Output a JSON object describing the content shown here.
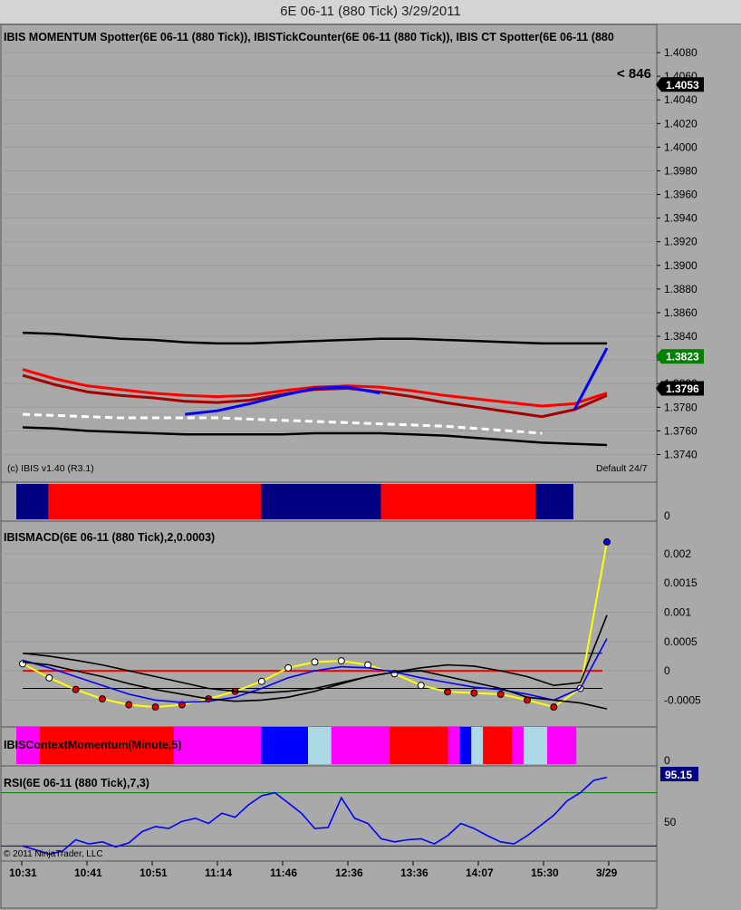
{
  "window": {
    "title": "6E 06-11 (880 Tick)  3/29/2011"
  },
  "colors": {
    "background": "#a9a9a9",
    "red": "#ff0000",
    "darkred": "#a50000",
    "blue": "#0000ff",
    "navy": "#000080",
    "magenta": "#ff00ff",
    "lightblue": "#add8e6",
    "yellow": "#ffff00",
    "cyan": "#00ffff",
    "black": "#000000",
    "white": "#ffffff",
    "green": "#008000"
  },
  "price_panel": {
    "header": "IBIS MOMENTUM Spotter(6E 06-11 (880 Tick)), IBISTickCounter(6E 06-11 (880 Tick)), IBIS CT Spotter(6E 06-11 (880",
    "copyright": "(c) IBIS v1.40 (R3.1)",
    "session_label": "Default 24/7",
    "tick_counter_label": "< 846",
    "price_ticks": [
      "1.4080",
      "1.4060",
      "1.4040",
      "1.4020",
      "1.4000",
      "1.3980",
      "1.3960",
      "1.3940",
      "1.3920",
      "1.3900",
      "1.3880",
      "1.3860",
      "1.3840",
      "1.3820",
      "1.3800",
      "1.3780",
      "1.3760",
      "1.3740"
    ],
    "badges": [
      {
        "value": "1.4053",
        "color": "#000000"
      },
      {
        "value": "1.3823",
        "color": "#008000"
      },
      {
        "value": "1.3796",
        "color": "#000000"
      }
    ]
  },
  "color_bar_1": {
    "zero_label": "0",
    "segments": [
      {
        "color": "navy",
        "from": 0.0,
        "to": 0.055
      },
      {
        "color": "red",
        "from": 0.055,
        "to": 0.42
      },
      {
        "color": "navy",
        "from": 0.42,
        "to": 0.625
      },
      {
        "color": "red",
        "from": 0.625,
        "to": 0.89
      },
      {
        "color": "navy",
        "from": 0.89,
        "to": 0.955
      }
    ]
  },
  "macd_panel": {
    "header": "IBISMACD(6E 06-11 (880 Tick),2,0.0003)",
    "ticks": [
      "0.002",
      "0.0015",
      "0.001",
      "0.0005",
      "0",
      "-0.0005"
    ]
  },
  "color_bar_2": {
    "header": "IBISContextMomentum(Minute,5)",
    "zero_label": "0",
    "segments": [
      {
        "color": "magenta",
        "from": 0.0,
        "to": 0.04
      },
      {
        "color": "red",
        "from": 0.04,
        "to": 0.27
      },
      {
        "color": "magenta",
        "from": 0.27,
        "to": 0.42
      },
      {
        "color": "blue",
        "from": 0.42,
        "to": 0.5
      },
      {
        "color": "lightblue",
        "from": 0.5,
        "to": 0.54
      },
      {
        "color": "magenta",
        "from": 0.54,
        "to": 0.64
      },
      {
        "color": "red",
        "from": 0.64,
        "to": 0.74
      },
      {
        "color": "magenta",
        "from": 0.74,
        "to": 0.76
      },
      {
        "color": "blue",
        "from": 0.76,
        "to": 0.78
      },
      {
        "color": "lightblue",
        "from": 0.78,
        "to": 0.8
      },
      {
        "color": "red",
        "from": 0.8,
        "to": 0.85
      },
      {
        "color": "magenta",
        "from": 0.85,
        "to": 0.87
      },
      {
        "color": "lightblue",
        "from": 0.87,
        "to": 0.91
      },
      {
        "color": "magenta",
        "from": 0.91,
        "to": 0.96
      }
    ]
  },
  "rsi_panel": {
    "header": "RSI(6E 06-11 (880 Tick),7,3)",
    "mid_label": "50",
    "badge": "95.15",
    "copyright": "© 2011 NinjaTrader, LLC"
  },
  "time_axis": {
    "labels": [
      "10:31",
      "10:41",
      "10:51",
      "11:14",
      "11:46",
      "12:36",
      "13:36",
      "14:07",
      "15:30",
      "3/29"
    ]
  },
  "chart_data": [
    {
      "type": "line",
      "name": "price_panel",
      "ylim": [
        1.3735,
        1.409
      ],
      "series": [
        {
          "color": "darkred",
          "values": [
            1.3807,
            1.3799,
            1.3793,
            1.379,
            1.3788,
            1.3785,
            1.3784,
            1.3786,
            1.3791,
            1.3795,
            1.3796,
            1.3793,
            1.3789,
            1.3784,
            1.378,
            1.3776,
            1.3772,
            1.3778,
            1.379
          ]
        },
        {
          "color": "red",
          "values": [
            1.3812,
            1.3804,
            1.3798,
            1.3795,
            1.3792,
            1.379,
            1.3789,
            1.379,
            1.3794,
            1.3797,
            1.3798,
            1.3797,
            1.3794,
            1.379,
            1.3787,
            1.3784,
            1.3781,
            1.3783,
            1.3792
          ]
        },
        {
          "color": "blue",
          "values": [
            null,
            null,
            null,
            null,
            null,
            1.3774,
            1.3777,
            1.3783,
            1.379,
            1.3796,
            1.3797,
            1.3792,
            null,
            null,
            null,
            null,
            null,
            1.3778,
            1.383
          ]
        },
        {
          "color": "black",
          "values": [
            1.3843,
            1.3842,
            1.384,
            1.3838,
            1.3837,
            1.3835,
            1.3834,
            1.3834,
            1.3835,
            1.3836,
            1.3837,
            1.3838,
            1.3838,
            1.3837,
            1.3836,
            1.3835,
            1.3834,
            1.3834,
            1.3834
          ]
        },
        {
          "color": "black",
          "values": [
            1.3763,
            1.3762,
            1.376,
            1.3759,
            1.3758,
            1.3757,
            1.3757,
            1.3757,
            1.3757,
            1.3758,
            1.3758,
            1.3758,
            1.3757,
            1.3756,
            1.3754,
            1.3752,
            1.375,
            1.3749,
            1.3748
          ]
        },
        {
          "color": "white",
          "values": [
            1.3774,
            1.3773,
            1.3772,
            1.3771,
            1.3771,
            1.3771,
            1.3771,
            1.377,
            1.3769,
            1.3768,
            1.3767,
            1.3766,
            1.3765,
            1.3764,
            1.3762,
            1.376,
            1.3758,
            null,
            null
          ]
        }
      ]
    },
    {
      "type": "line",
      "name": "macd_panel",
      "ylim": [
        -0.00085,
        0.0024
      ],
      "series": [
        {
          "color": "yellow",
          "values": [
            0.00012,
            -0.00012,
            -0.00032,
            -0.00048,
            -0.00058,
            -0.00062,
            -0.00058,
            -0.00048,
            -0.00035,
            -0.00018,
            5e-05,
            0.00015,
            0.00017,
            0.0001,
            -5e-05,
            -0.00025,
            -0.00036,
            -0.00038,
            -0.0004,
            -0.0005,
            -0.00062,
            -0.0003,
            0.0022
          ]
        },
        {
          "color": "blue",
          "values": [
            0.00018,
            5e-05,
            -0.0001,
            -0.00025,
            -0.0004,
            -0.0005,
            -0.00054,
            -0.00052,
            -0.00045,
            -0.0003,
            -0.00012,
            0.0,
            7e-05,
            5e-05,
            -2e-05,
            -0.00012,
            -0.0002,
            -0.00028,
            -0.00032,
            -0.0004,
            -0.0005,
            -0.0003,
            0.00055
          ]
        },
        {
          "color": "black",
          "values": [
            0.0003,
            0.00025,
            0.00018,
            0.0001,
            0.0,
            -0.0001,
            -0.0002,
            -0.0003,
            -0.00035,
            -0.00038,
            -0.00035,
            -0.0003,
            -0.0002,
            -0.0001,
            -2e-05,
            5e-05,
            0.0001,
            8e-05,
            0.0,
            -0.0001,
            -0.00025,
            -0.0002,
            0.00095
          ]
        },
        {
          "color": "black",
          "values": [
            0.00015,
            0.0001,
            0.0,
            -0.0001,
            -0.00022,
            -0.00032,
            -0.0004,
            -0.00048,
            -0.00052,
            -0.0005,
            -0.00045,
            -0.00035,
            -0.00022,
            -0.0001,
            -2e-05,
            0.0,
            -0.0001,
            -0.0002,
            -0.0003,
            -0.00045,
            -0.0005,
            -0.00055,
            -0.00065
          ]
        }
      ],
      "reference_lines": [
        {
          "color": "red",
          "value": 0.0
        },
        {
          "color": "black",
          "value": 0.0003
        },
        {
          "color": "black",
          "value": -0.0003
        }
      ]
    },
    {
      "type": "line",
      "name": "rsi_panel",
      "ylim": [
        15,
        100
      ],
      "series": [
        {
          "color": "blue",
          "values": [
            28,
            24,
            20,
            23,
            34,
            30,
            32,
            27,
            31,
            42,
            47,
            45,
            52,
            55,
            50,
            60,
            56,
            68,
            77,
            80,
            70,
            60,
            45,
            46,
            75,
            55,
            50,
            35,
            32,
            34,
            35,
            30,
            38,
            50,
            45,
            38,
            32,
            30,
            38,
            48,
            58,
            72,
            80,
            92,
            95
          ]
        }
      ],
      "reference_lines": [
        {
          "color": "green",
          "value": 80
        },
        {
          "color": "navy",
          "value": 28
        }
      ]
    }
  ]
}
